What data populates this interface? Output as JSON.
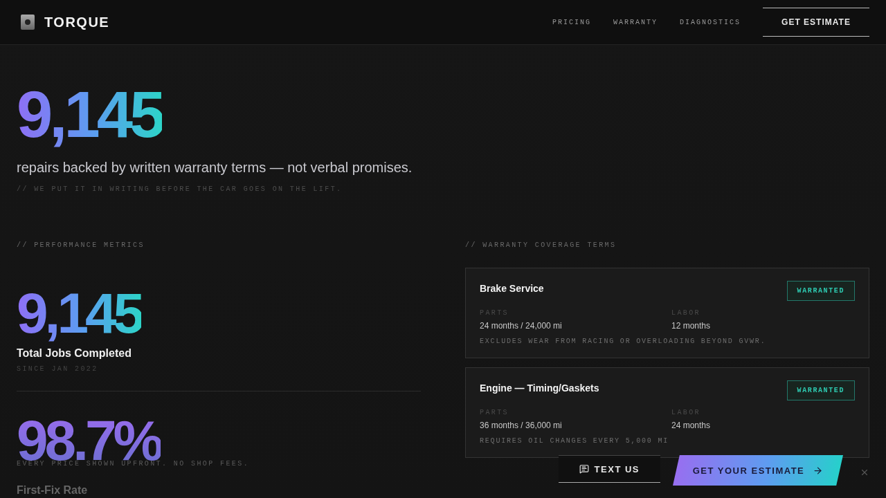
{
  "header": {
    "brand": "TORQUE",
    "nav": [
      "PRICING",
      "WARRANTY",
      "DIAGNOSTICS"
    ],
    "cta": "GET ESTIMATE"
  },
  "hero": {
    "number": "9,145",
    "subtitle": "repairs backed by written warranty terms — not verbal promises.",
    "note": "// WE PUT IT IN WRITING BEFORE THE CAR GOES ON THE LIFT."
  },
  "metrics": {
    "heading": "// PERFORMANCE METRICS",
    "items": [
      {
        "value": "9,145",
        "label": "Total Jobs Completed",
        "sub": "SINCE JAN 2022"
      },
      {
        "value": "98.7%",
        "label": "First-Fix Rate"
      }
    ]
  },
  "warranty": {
    "heading": "// WARRANTY COVERAGE TERMS",
    "cards": [
      {
        "title": "Brake Service",
        "badge": "WARRANTED",
        "parts_label": "PARTS",
        "parts": "24 months / 24,000 mi",
        "labor_label": "LABOR",
        "labor": "12 months",
        "note": "EXCLUDES WEAR FROM RACING OR OVERLOADING BEYOND GVWR."
      },
      {
        "title": "Engine — Timing/Gaskets",
        "badge": "WARRANTED",
        "parts_label": "PARTS",
        "parts": "36 months / 36,000 mi",
        "labor_label": "LABOR",
        "labor": "24 months",
        "note": "REQUIRES OIL CHANGES EVERY 5,000 MI"
      }
    ]
  },
  "sticky_bar": {
    "note": "EVERY PRICE SHOWN UPFRONT. NO SHOP FEES.",
    "text_button": "TEXT US",
    "estimate_button": "GET YOUR ESTIMATE"
  }
}
